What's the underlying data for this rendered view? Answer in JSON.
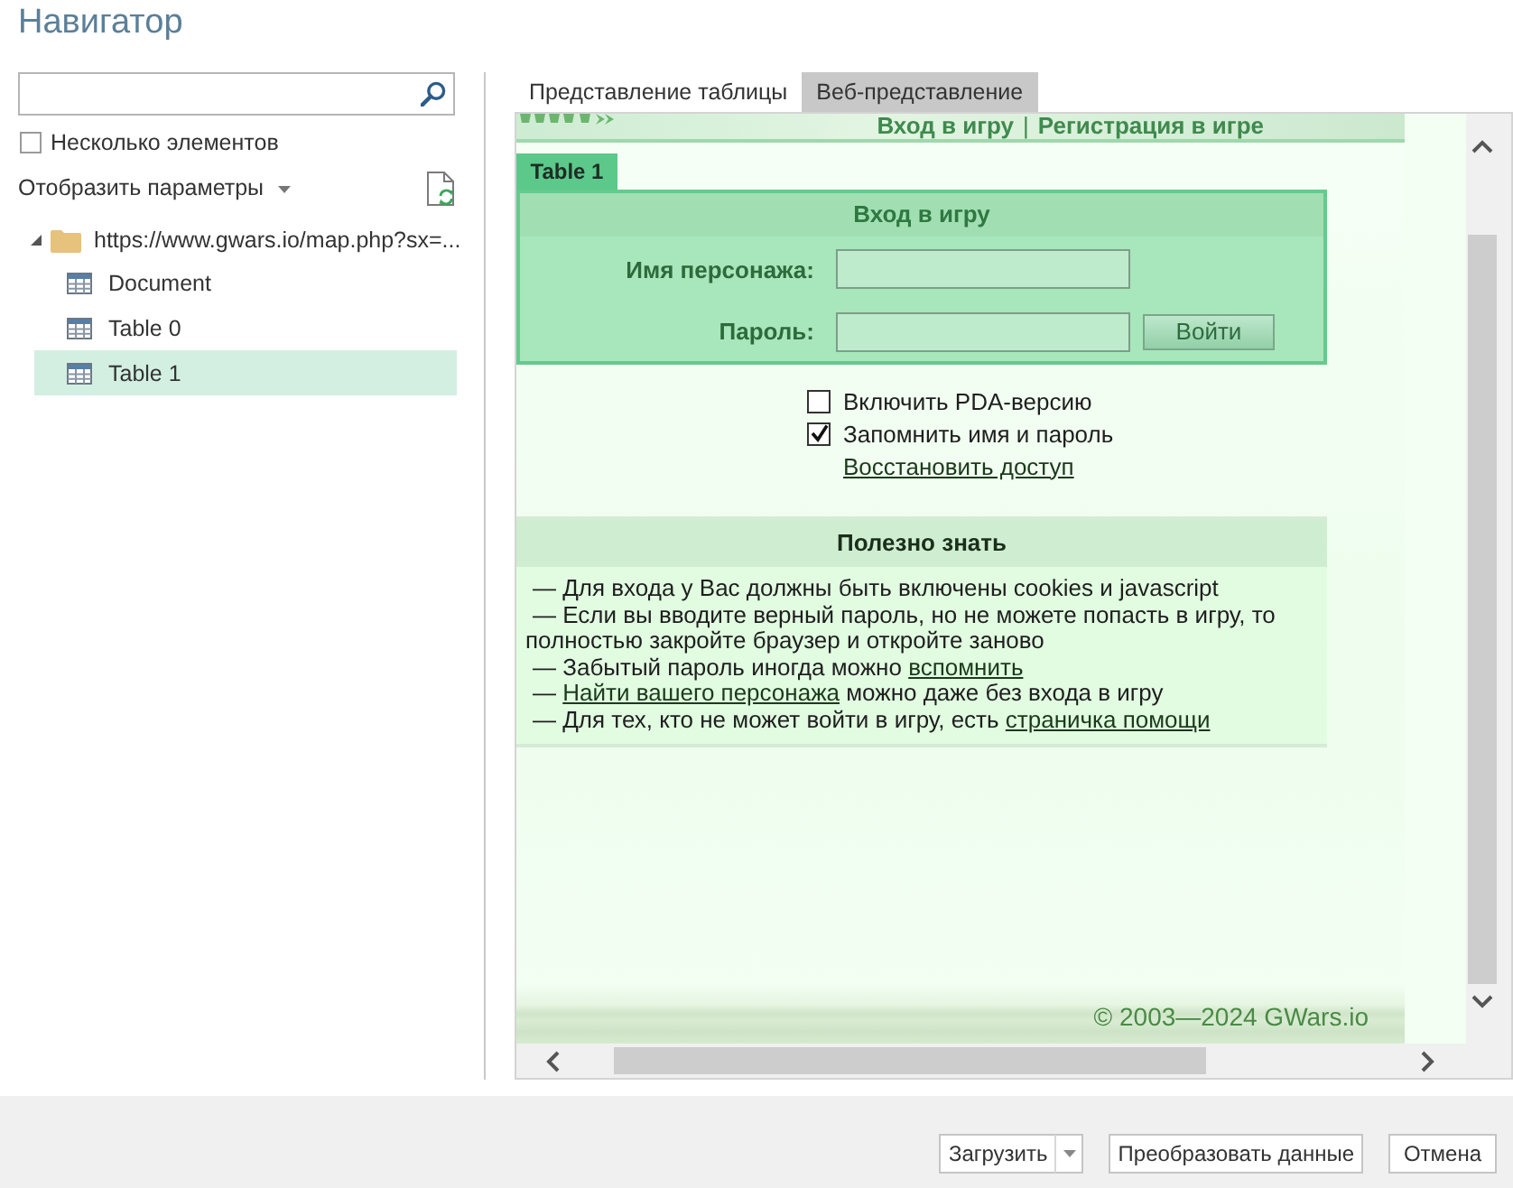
{
  "window": {
    "title": "Навигатор"
  },
  "sidebar": {
    "multi_select": {
      "label": "Несколько элементов",
      "checked": false
    },
    "display_options": {
      "label": "Отобразить параметры"
    },
    "tree": [
      {
        "label": "https://www.gwars.io/map.php?sx=...",
        "kind": "folder",
        "expanded": true,
        "selected": false,
        "children": [
          {
            "label": "Document",
            "kind": "table",
            "selected": false
          },
          {
            "label": "Table 0",
            "kind": "table",
            "selected": false
          },
          {
            "label": "Table 1",
            "kind": "table",
            "selected": true
          }
        ]
      }
    ]
  },
  "preview": {
    "tabs": [
      {
        "label": "Представление таблицы",
        "selected": false
      },
      {
        "label": "Веб-представление",
        "selected": true
      }
    ],
    "web_page": {
      "nav_links": [
        "Вход в игру",
        "Регистрация в игре"
      ],
      "nav_separator": "|",
      "table_tag": "Table 1",
      "login": {
        "title": "Вход в игру",
        "fields": [
          {
            "label": "Имя персонажа:"
          },
          {
            "label": "Пароль:"
          }
        ],
        "submit": "Войти"
      },
      "options": [
        {
          "label": "Включить PDA-версию",
          "checked": false
        },
        {
          "label": "Запомнить имя и пароль",
          "checked": true
        }
      ],
      "restore_link": "Восстановить доступ",
      "tips": {
        "title": "Полезно знать",
        "items": [
          {
            "parts": [
              {
                "kind": "text",
                "text": "— Для входа у Вас должны быть включены cookies и javascript"
              }
            ]
          },
          {
            "parts": [
              {
                "kind": "text",
                "text": "— Если вы вводите верный пароль, но не можете попасть в игру, то полностью закройте браузер и откройте заново"
              }
            ]
          },
          {
            "parts": [
              {
                "kind": "text",
                "text": "— Забытый пароль иногда можно "
              },
              {
                "kind": "link",
                "text": "вспомнить"
              }
            ]
          },
          {
            "parts": [
              {
                "kind": "text",
                "text": "— "
              },
              {
                "kind": "link",
                "text": "Найти вашего персонажа"
              },
              {
                "kind": "text",
                "text": " можно даже без входа в игру"
              }
            ]
          },
          {
            "parts": [
              {
                "kind": "text",
                "text": "— Для тех, кто не может войти в игру, есть "
              },
              {
                "kind": "link",
                "text": "страничка помощи"
              }
            ]
          }
        ]
      },
      "copyright": "© 2003—2024 GWars.io"
    }
  },
  "footer": {
    "buttons": [
      {
        "label": "Загрузить",
        "kind": "split"
      },
      {
        "label": "Преобразовать данные",
        "kind": "plain"
      },
      {
        "label": "Отмена",
        "kind": "plain"
      }
    ]
  }
}
